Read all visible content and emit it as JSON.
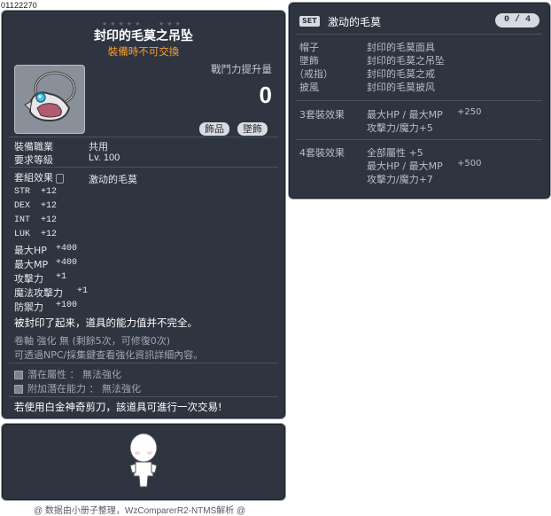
{
  "item_id": "01122270",
  "stars_left": "★★★★★",
  "stars_right": "★★★",
  "item": {
    "name": "封印的毛莫之吊坠",
    "trade_note": "裝備時不可交換",
    "power_label": "戰鬥力提升量",
    "power_value": "0",
    "tags": [
      "飾品",
      "墜飾"
    ]
  },
  "requirements": {
    "job_label": "裝備職業",
    "job_value": "共用",
    "level_label": "要求等級",
    "level_value": "Lv. 100"
  },
  "set_effect": {
    "label": "套組效果",
    "name": "激动的毛莫"
  },
  "stats": [
    {
      "name": "STR",
      "value": "+12"
    },
    {
      "name": "DEX",
      "value": "+12"
    },
    {
      "name": "INT",
      "value": "+12"
    },
    {
      "name": "LUK",
      "value": "+12"
    },
    {
      "name": "最大HP",
      "value": "+400"
    },
    {
      "name": "最大MP",
      "value": "+400"
    },
    {
      "name": "攻擊力",
      "value": "+1"
    },
    {
      "name": "魔法攻擊力",
      "value": "+1"
    },
    {
      "name": "防禦力",
      "value": "+100"
    }
  ],
  "description": "被封印了起来，道具的能力值并不完全。",
  "scroll_line": "卷軸 強化 無 (剩餘5次，可修復0次)",
  "npc_line": "可透過NPC/採集鍵查看強化資訊詳細內容。",
  "potential": {
    "label": "潛在屬性 ： 無法強化",
    "bonus_label": "附加潛在能力 ： 無法強化"
  },
  "scissors_note": "若使用白金神奇剪刀，該道具可進行一次交易!",
  "set_panel": {
    "badge": "SET",
    "title": "激动的毛莫",
    "count": "0 / 4",
    "parts": [
      {
        "slot": "帽子",
        "item": "封印的毛莫面具"
      },
      {
        "slot": "墜飾",
        "item": "封印的毛莫之吊坠"
      },
      {
        "slot": "（戒指）",
        "item": "封印的毛莫之戒"
      },
      {
        "slot": "披風",
        "item": "封印的毛莫披风"
      }
    ],
    "bonus3": {
      "label": "3套裝效果",
      "lines": [
        {
          "stat": "最大HP / 最大MP",
          "value": "+250"
        },
        {
          "stat": "攻擊力/魔力+5",
          "value": ""
        }
      ]
    },
    "bonus4": {
      "label": "4套裝效果",
      "lines": [
        {
          "stat": "全部屬性 +5",
          "value": ""
        },
        {
          "stat": "最大HP / 最大MP",
          "value": "+500"
        },
        {
          "stat": "攻擊力/魔力+7",
          "value": ""
        }
      ]
    }
  },
  "footer": "@ 数据由小册子整理，WzComparerR2-NTMS解析 @",
  "colors": {
    "panel_bg": "#2e3440",
    "title": "#ffffff",
    "trade_note": "#ff9e2a",
    "muted": "#a1a7b1"
  }
}
